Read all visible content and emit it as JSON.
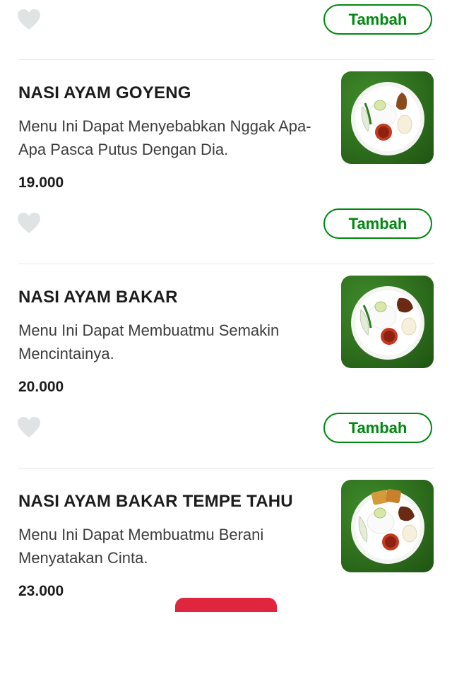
{
  "actions": {
    "add_label": "Tambah"
  },
  "items": [
    {
      "name": "NASI AYAM GOYENG",
      "description": "Menu Ini Dapat Menyebabkan Nggak Apa-Apa Pasca Putus Dengan Dia.",
      "price": "19.000"
    },
    {
      "name": "NASI AYAM BAKAR",
      "description": "Menu Ini Dapat Membuatmu Semakin Mencintainya.",
      "price": "20.000"
    },
    {
      "name": "NASI AYAM BAKAR TEMPE TAHU",
      "description": "Menu Ini Dapat Membuatmu Berani Menyatakan Cinta.",
      "price": "23.000"
    }
  ],
  "colors": {
    "accent_green": "#00880f",
    "heart_gray": "#dfe3e3",
    "divider": "#e6e6e6",
    "bottom_accent": "#e0263f"
  },
  "icons": {
    "favorite": "heart-icon"
  }
}
